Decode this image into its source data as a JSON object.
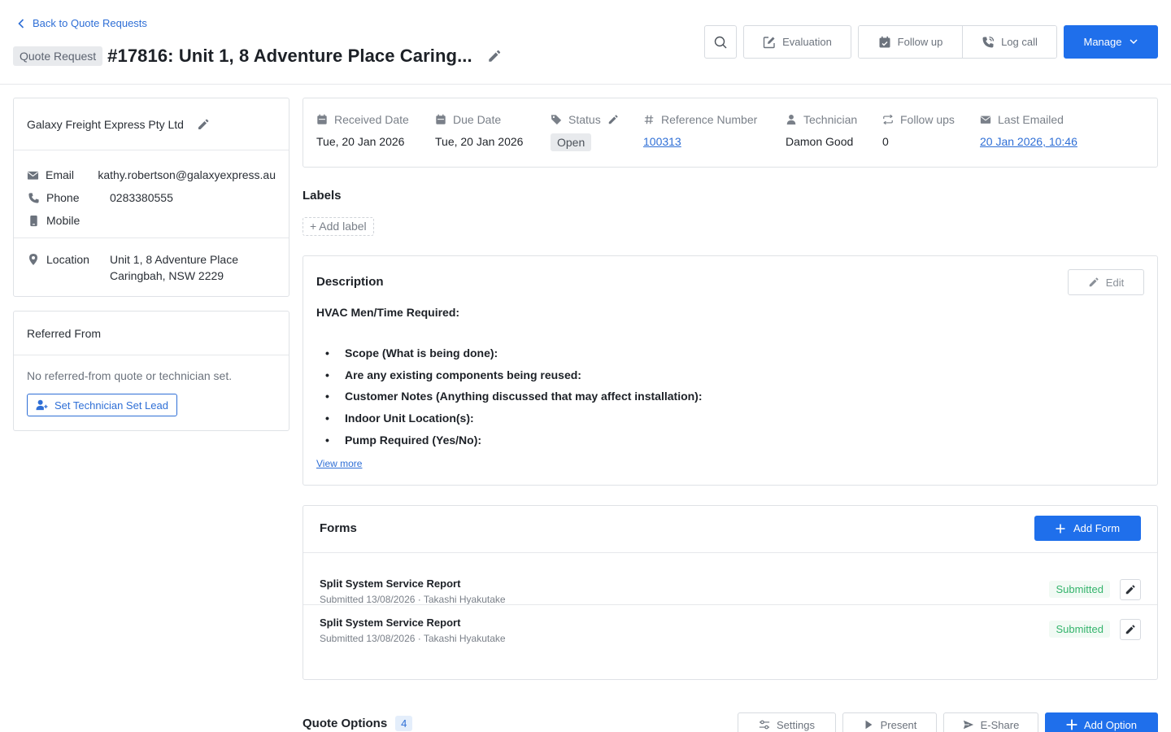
{
  "header": {
    "back_link": "Back to Quote Requests",
    "type_badge": "Quote Request",
    "title": "#17816: Unit 1, 8 Adventure Place Caring...",
    "actions": {
      "evaluation": "Evaluation",
      "follow_up": "Follow up",
      "log_call": "Log call",
      "manage": "Manage"
    }
  },
  "contact": {
    "company": "Galaxy Freight Express Pty Ltd",
    "email_label": "Email",
    "email": "kathy.robertson@galaxyexpress.au",
    "phone_label": "Phone",
    "phone": "0283380555",
    "mobile_label": "Mobile",
    "mobile": "",
    "location_label": "Location",
    "location_line1": "Unit 1, 8 Adventure Place",
    "location_line2": "Caringbah, NSW 2229"
  },
  "referred": {
    "title": "Referred From",
    "empty_text": "No referred-from quote or technician set.",
    "button": "Set Technician Set Lead"
  },
  "info": {
    "received_label": "Received Date",
    "received": "Tue, 20 Jan 2026",
    "due_label": "Due Date",
    "due": "Tue, 20 Jan 2026",
    "status_label": "Status",
    "status": "Open",
    "reference_label": "Reference Number",
    "reference": "100313",
    "technician_label": "Technician",
    "technician": "Damon Good",
    "followups_label": "Follow ups",
    "followups": "0",
    "emailed_label": "Last Emailed",
    "emailed": "20 Jan 2026, 10:46"
  },
  "labels": {
    "title": "Labels",
    "add": "+ Add label"
  },
  "description": {
    "title": "Description",
    "edit": "Edit",
    "heading": "HVAC Men/Time Required:",
    "items": [
      "Scope (What is being done):",
      "Are any existing components being reused:",
      "Customer Notes (Anything discussed that may affect installation):",
      "Indoor Unit Location(s):",
      "Pump Required (Yes/No):"
    ],
    "view_more": "View more"
  },
  "forms": {
    "title": "Forms",
    "add": "Add Form",
    "rows": [
      {
        "name": "Split System Service Report",
        "meta": "Submitted 13/08/2026 · Takashi Hyakutake",
        "status": "Submitted"
      },
      {
        "name": "Split System Service Report",
        "meta": "Submitted 13/08/2026 · Takashi Hyakutake",
        "status": "Submitted"
      }
    ]
  },
  "quote_options": {
    "title": "Quote Options",
    "count": "4",
    "settings": "Settings",
    "present": "Present",
    "eshare": "E-Share",
    "add": "Add Option"
  },
  "colors": {
    "primary": "#1f6feb",
    "link": "#2f6fd6",
    "success": "#34b46c",
    "border": "#dfe2e6"
  }
}
